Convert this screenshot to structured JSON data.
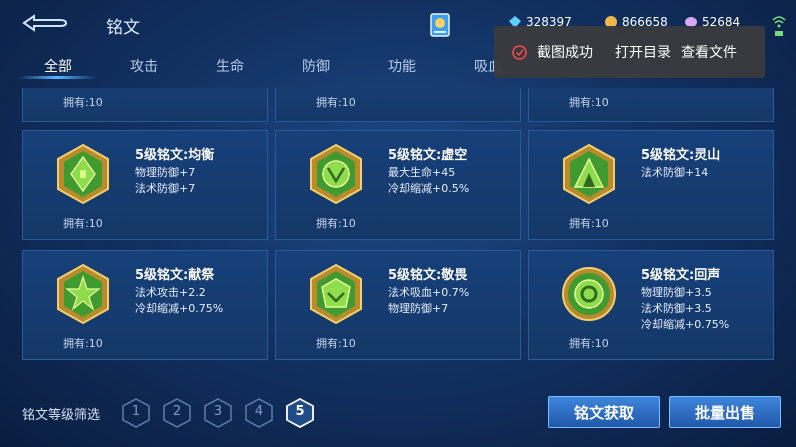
{
  "header": {
    "title": "铭文",
    "resources": [
      {
        "name": "diamond",
        "value": "328397",
        "color": "#5fd0ff"
      },
      {
        "name": "gold",
        "value": "866658",
        "color": "#f0b84a"
      },
      {
        "name": "crystal",
        "value": "52684",
        "color": "#d8a9f0"
      }
    ]
  },
  "tabs": [
    "全部",
    "攻击",
    "生命",
    "防御",
    "功能",
    "吸血"
  ],
  "active_tab": "全部",
  "toast": {
    "message": "截图成功",
    "open_dir": "打开目录",
    "view_file": "查看文件"
  },
  "top_row_owned": [
    "拥有:10",
    "拥有:10",
    "拥有:10"
  ],
  "cards": [
    {
      "name": "5级铭文:均衡",
      "attrs": [
        "物理防御+7",
        "法术防御+7"
      ],
      "owned": "拥有:10",
      "icon": "balance-emblem-icon"
    },
    {
      "name": "5级铭文:虚空",
      "attrs": [
        "最大生命+45",
        "冷却缩减+0.5%"
      ],
      "owned": "拥有:10",
      "icon": "void-emblem-icon"
    },
    {
      "name": "5级铭文:灵山",
      "attrs": [
        "法术防御+14"
      ],
      "owned": "拥有:10",
      "icon": "mountain-emblem-icon"
    },
    {
      "name": "5级铭文:献祭",
      "attrs": [
        "法术攻击+2.2",
        "冷却缩减+0.75%"
      ],
      "owned": "拥有:10",
      "icon": "sacrifice-emblem-icon"
    },
    {
      "name": "5级铭文:敬畏",
      "attrs": [
        "法术吸血+0.7%",
        "物理防御+7"
      ],
      "owned": "拥有:10",
      "icon": "awe-emblem-icon"
    },
    {
      "name": "5级铭文:回声",
      "attrs": [
        "物理防御+3.5",
        "法术防御+3.5",
        "冷却缩减+0.75%"
      ],
      "owned": "拥有:10",
      "icon": "echo-emblem-icon"
    }
  ],
  "filter": {
    "label": "铭文等级筛选",
    "levels": [
      "1",
      "2",
      "3",
      "4",
      "5"
    ],
    "selected": "5"
  },
  "buttons": {
    "acquire": "铭文获取",
    "bulk_sell": "批量出售"
  }
}
